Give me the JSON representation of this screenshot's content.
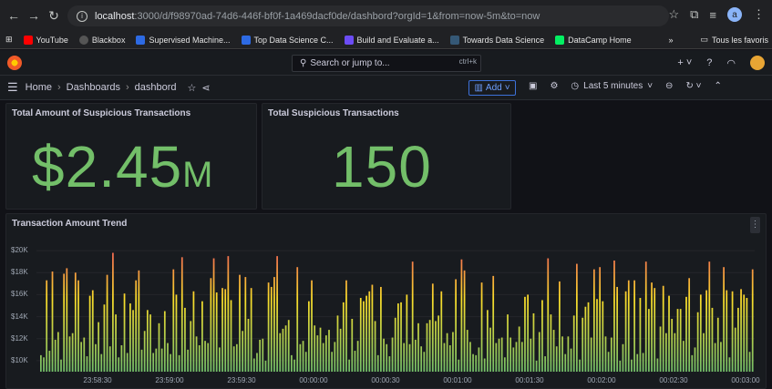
{
  "browser": {
    "url_host": "localhost",
    "url_path": ":3000/d/f98970ad-74d6-446f-bf0f-1a469dacf0de/dashbord?orgId=1&from=now-5m&to=now",
    "profile_initial": "a",
    "bookmarks": [
      {
        "label": "YouTube",
        "color": "#ff0000"
      },
      {
        "label": "Blackbox",
        "color": "#555555"
      },
      {
        "label": "Supervised Machine...",
        "color": "#2d6ae3"
      },
      {
        "label": "Top Data Science C...",
        "color": "#2d6ae3"
      },
      {
        "label": "Build and Evaluate a...",
        "color": "#6c4cf5"
      },
      {
        "label": "Towards Data Science",
        "color": "#355876"
      },
      {
        "label": "DataCamp Home",
        "color": "#03ef62"
      }
    ],
    "overflow": "»",
    "all_bookmarks": "Tous les favoris"
  },
  "grafana": {
    "search_placeholder": "Search or jump to...",
    "search_shortcut": "ctrl+k",
    "breadcrumb": [
      "Home",
      "Dashboards",
      "dashbord"
    ],
    "add_label": "Add",
    "time_range": "Last 5 minutes"
  },
  "panels": {
    "amount": {
      "title": "Total Amount of Suspicious Transactions",
      "value": "$2.45",
      "unit": "M"
    },
    "count": {
      "title": "Total Suspicious Transactions",
      "value": "150"
    },
    "trend": {
      "title": "Transaction Amount Trend"
    }
  },
  "chart_data": {
    "type": "bar",
    "title": "Transaction Amount Trend",
    "y_ticks": [
      "$20K",
      "$18K",
      "$16K",
      "$14K",
      "$12K",
      "$10K"
    ],
    "ylim": [
      9000,
      21000
    ],
    "x_ticks": [
      "23:58:30",
      "23:59:00",
      "23:59:30",
      "00:00:00",
      "00:00:30",
      "00:01:00",
      "00:01:30",
      "00:02:00",
      "00:02:30",
      "00:03:00"
    ],
    "color_low": "#73bf69",
    "color_high": "#f2495c",
    "values": [
      10500,
      10300,
      17300,
      10900,
      18100,
      11900,
      12600,
      10100,
      17900,
      18400,
      12200,
      12500,
      18000,
      17300,
      11700,
      12100,
      10400,
      15900,
      16400,
      11500,
      13500,
      10600,
      15100,
      17800,
      11300,
      19800,
      14200,
      10300,
      11400,
      16100,
      10700,
      15200,
      14600,
      17300,
      18200,
      11000,
      12700,
      14600,
      14200,
      10700,
      11100,
      13400,
      11100,
      14500,
      11600,
      10600,
      18300,
      16000,
      10500,
      19400,
      14800,
      11000,
      13600,
      16300,
      12200,
      11400,
      15400,
      11800,
      11600,
      17500,
      19300,
      16200,
      11200,
      16600,
      16500,
      19500,
      15500,
      11300,
      11500,
      17800,
      12700,
      17600,
      13800,
      16600,
      10200,
      10700,
      11900,
      12000,
      10000,
      17100,
      16700,
      17600,
      19500,
      12500,
      12900,
      13200,
      13700,
      10500,
      10100,
      18500,
      11500,
      11800,
      10800,
      15400,
      17300,
      13200,
      12300,
      13000,
      11600,
      12300,
      12800,
      10800,
      11700,
      14100,
      12900,
      15300,
      17300,
      10100,
      13800,
      10900,
      11800,
      15700,
      15400,
      15900,
      16300,
      16900,
      13600,
      10500,
      16700,
      12000,
      11500,
      10400,
      12100,
      13900,
      15200,
      15300,
      11600,
      16000,
      11500,
      19000,
      11900,
      13400,
      11300,
      10800,
      13400,
      13700,
      17000,
      13600,
      14100,
      16300,
      11600,
      12500,
      11400,
      12600,
      17400,
      10100,
      19200,
      18200,
      12800,
      11700,
      10600,
      10500,
      11200,
      17100,
      10200,
      14600,
      13000,
      17700,
      11600,
      12000,
      12100,
      10300,
      14200,
      12100,
      11200,
      11700,
      13100,
      11700,
      15800,
      16000,
      12000,
      14300,
      10000,
      12600,
      15500,
      10400,
      19300,
      14200,
      12800,
      11300,
      17200,
      12200,
      10600,
      12200,
      11100,
      14100,
      18800,
      10100,
      13900,
      14900,
      15300,
      12100,
      18300,
      15600,
      18500,
      15400,
      12200,
      10800,
      12100,
      19100,
      16700,
      10000,
      11500,
      16300,
      17300,
      10100,
      17300,
      10600,
      15700,
      10700,
      19000,
      14700,
      17100,
      16600,
      10200,
      13100,
      16800,
      12500,
      15900,
      13800,
      12500,
      14700,
      14700,
      11800,
      15800,
      17500,
      10500,
      11200,
      14400,
      16000,
      12500,
      16400,
      19000,
      14800,
      11600,
      13900,
      11700,
      18500,
      16400,
      10300,
      16300,
      13000,
      14800,
      16500,
      16000,
      15700,
      10800,
      18300
    ]
  }
}
